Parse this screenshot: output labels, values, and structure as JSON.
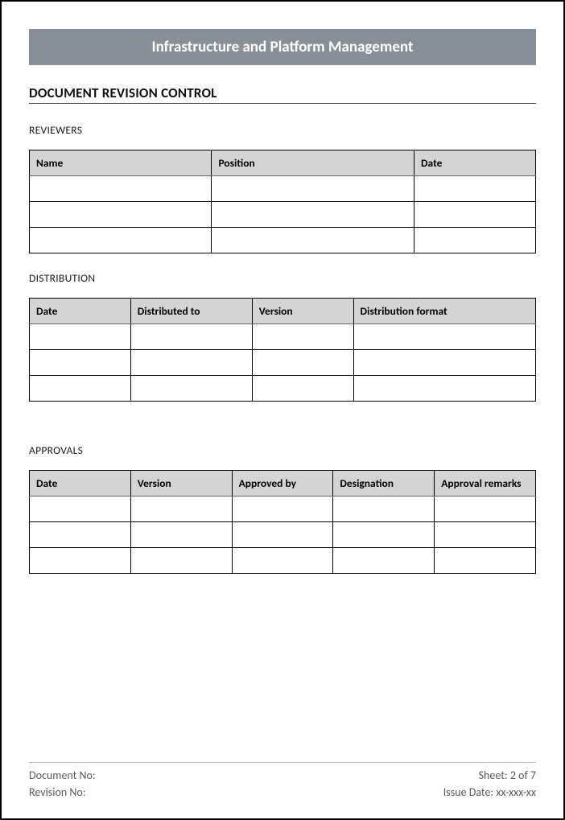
{
  "banner": "Infrastructure and Platform Management",
  "section_title": "DOCUMENT REVISION CONTROL",
  "reviewers": {
    "label": "REVIEWERS",
    "headers": [
      "Name",
      "Position",
      "Date"
    ],
    "rows": [
      [
        "",
        "",
        ""
      ],
      [
        "",
        "",
        ""
      ],
      [
        "",
        "",
        ""
      ]
    ]
  },
  "distribution": {
    "label": "DISTRIBUTION",
    "headers": [
      "Date",
      "Distributed to",
      "Version",
      "Distribution format"
    ],
    "rows": [
      [
        "",
        "",
        "",
        ""
      ],
      [
        "",
        "",
        "",
        ""
      ],
      [
        "",
        "",
        "",
        ""
      ]
    ]
  },
  "approvals": {
    "label": "APPROVALS",
    "headers": [
      "Date",
      "Version",
      "Approved by",
      "Designation",
      "Approval remarks"
    ],
    "rows": [
      [
        "",
        "",
        "",
        "",
        ""
      ],
      [
        "",
        "",
        "",
        "",
        ""
      ],
      [
        "",
        "",
        "",
        "",
        ""
      ]
    ]
  },
  "footer": {
    "doc_no_label": "Document No:",
    "rev_no_label": "Revision No:",
    "sheet_label": "Sheet: 2 of 7",
    "issue_label": "Issue Date: xx-xxx-xx"
  },
  "col_widths": {
    "reviewers": [
      "36%",
      "40%",
      "24%"
    ],
    "distribution": [
      "20%",
      "24%",
      "20%",
      "36%"
    ],
    "approvals": [
      "20%",
      "20%",
      "20%",
      "20%",
      "20%"
    ]
  }
}
